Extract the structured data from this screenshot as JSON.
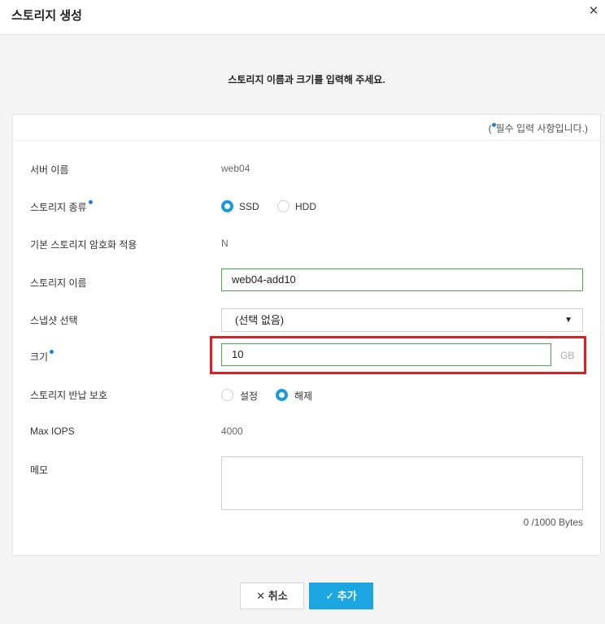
{
  "dialog": {
    "title": "스토리지 생성",
    "close_icon": "close-icon",
    "instruction": "스토리지 이름과 크기를 입력해 주세요.",
    "required_note_open": "(",
    "required_note_text": "필수 입력 사항입니다.)"
  },
  "form": {
    "server_name": {
      "label": "서버 이름",
      "value": "web04"
    },
    "storage_type": {
      "label": "스토리지 종류",
      "options": [
        {
          "label": "SSD",
          "selected": true
        },
        {
          "label": "HDD",
          "selected": false
        }
      ]
    },
    "encryption": {
      "label": "기본 스토리지 암호화 적용",
      "value": "N"
    },
    "storage_name": {
      "label": "스토리지 이름",
      "value": "web04-add10"
    },
    "snapshot": {
      "label": "스냅샷 선택",
      "value": "(선택 없음)"
    },
    "size": {
      "label": "크기",
      "value": "10",
      "unit": "GB"
    },
    "return_protection": {
      "label": "스토리지 반납 보호",
      "options": [
        {
          "label": "설정",
          "selected": false
        },
        {
          "label": "해제",
          "selected": true
        }
      ]
    },
    "max_iops": {
      "label": "Max IOPS",
      "value": "4000"
    },
    "memo": {
      "label": "메모",
      "value": "",
      "counter": "0 /1000 Bytes"
    }
  },
  "buttons": {
    "cancel": "취소",
    "add": "추가"
  },
  "colors": {
    "accent": "#1a9ad8",
    "valid_border": "#4caa4c",
    "highlight": "#e02020",
    "primary_button": "#1ba6e2"
  }
}
